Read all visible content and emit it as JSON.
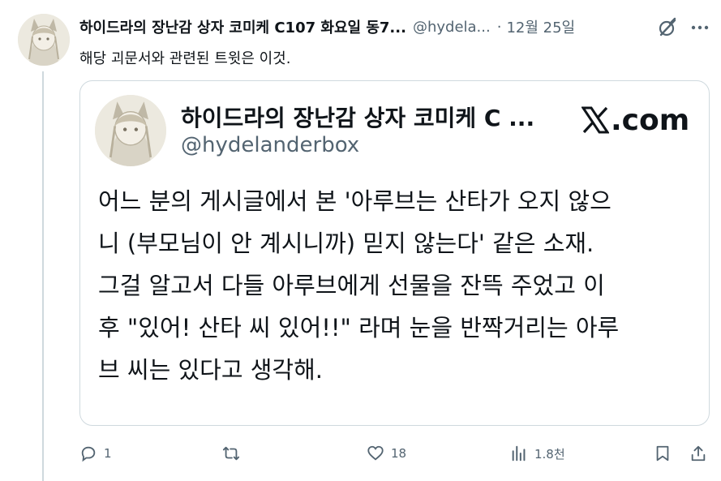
{
  "post": {
    "display_name": "하이드라의 장난감 상자 코미케 C107 화요일 동7...",
    "handle": "@hydela...",
    "separator": "·",
    "time": "12월 25일",
    "text": "해당 괴문서와 관련된 트윗은 이것."
  },
  "card": {
    "display_name": "하이드라의 장난감 상자 코미케 C ...",
    "handle": "@hydelanderbox",
    "site": ".com",
    "body_lines": [
      "어느 분의 게시글에서 본 '아루브는 산타가 오지 않으",
      "니 (부모님이 안 계시니까) 믿지 않는다' 같은 소재.",
      "그걸 알고서 다들 아루브에게 선물을 잔뜩 주었고 이",
      "후 \"있어! 산타 씨 있어!!\" 라며 눈을 반짝거리는 아루",
      "브 씨는 있다고 생각해."
    ]
  },
  "actions": {
    "reply": {
      "icon": "reply-icon",
      "count": "1"
    },
    "repost": {
      "icon": "repost-icon",
      "count": ""
    },
    "like": {
      "icon": "heart-icon",
      "count": "18"
    },
    "views": {
      "icon": "views-icon",
      "count": "1.8천"
    },
    "bookmark": {
      "icon": "bookmark-icon"
    },
    "share": {
      "icon": "share-icon"
    }
  },
  "colors": {
    "text": "#0f1419",
    "secondary": "#536471",
    "border": "#cfd9de"
  }
}
